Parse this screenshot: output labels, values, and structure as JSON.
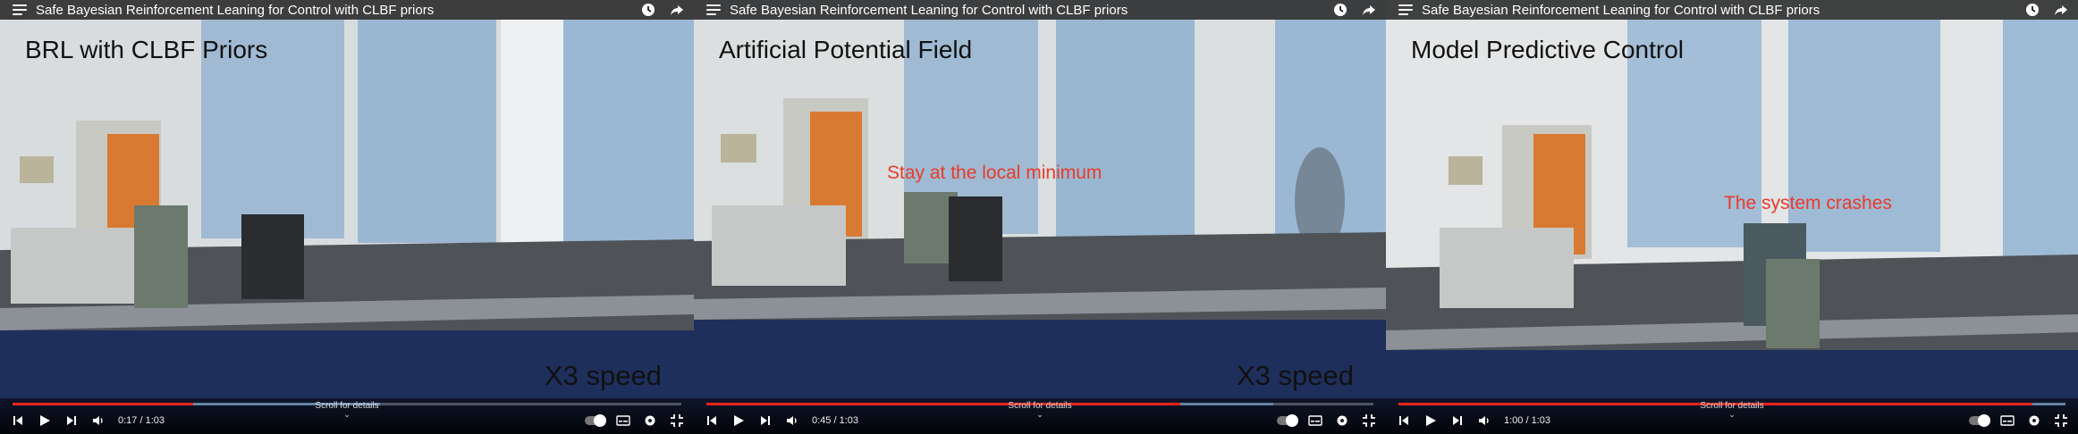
{
  "players": [
    {
      "title": "Safe Bayesian Reinforcement Leaning for Control with CLBF priors",
      "overlay_title": "BRL with CLBF Priors",
      "overlay_note": "",
      "overlay_speed": "X3 speed",
      "time": "0:17 / 1:03",
      "progress": 0.27,
      "buffer": 0.55,
      "scroll_hint": "Scroll for details"
    },
    {
      "title": "Safe Bayesian Reinforcement Leaning for Control with CLBF priors",
      "overlay_title": "Artificial Potential Field",
      "overlay_note": "Stay at the local minimum",
      "overlay_speed": "X3 speed",
      "time": "0:45 / 1:03",
      "progress": 0.71,
      "buffer": 0.85,
      "scroll_hint": "Scroll for details"
    },
    {
      "title": "Safe Bayesian Reinforcement Leaning for Control with CLBF priors",
      "overlay_title": "Model Predictive Control",
      "overlay_note": "The system crashes",
      "overlay_speed": "",
      "time": "1:00 / 1:03",
      "progress": 0.95,
      "buffer": 1.0,
      "scroll_hint": "Scroll for details"
    }
  ],
  "icons": {
    "menu": "menu-icon",
    "watch_later": "clock-icon",
    "share": "share-icon",
    "prev": "skip-previous-icon",
    "play": "play-icon",
    "next": "skip-next-icon",
    "volume": "volume-icon",
    "autoplay": "autoplay-toggle-icon",
    "subtitles": "subtitles-icon",
    "settings": "gear-icon",
    "exit_fullscreen": "exit-fullscreen-icon"
  },
  "colors": {
    "progress_played": "#e8241c",
    "note_text": "#ea3a2a"
  }
}
